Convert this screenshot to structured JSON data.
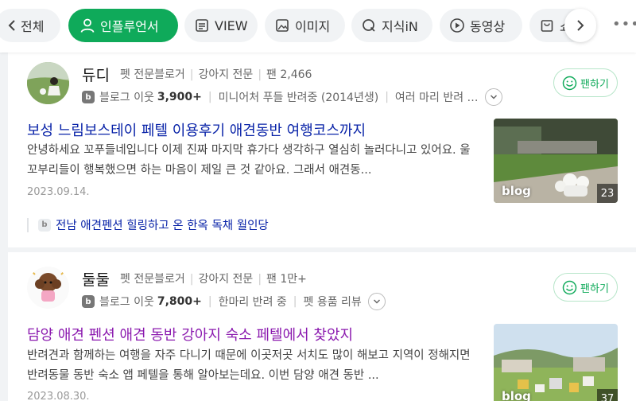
{
  "tabs": {
    "back_label": "전체",
    "influencer_label": "인플루언서",
    "view_label": "VIEW",
    "image_label": "이미지",
    "kin_label": "지식iN",
    "video_label": "동영상",
    "shop_label": "쇼"
  },
  "colors": {
    "accent": "#0faa5a",
    "link": "#0923a8",
    "visited": "#8b1aaf"
  },
  "results": [
    {
      "name": "듀디",
      "role": "펫 전문블로거",
      "specialty": "강아지 전문",
      "fans": "팬 2,466",
      "neighbors_label": "블로그 이웃",
      "neighbors_count": "3,900+",
      "tag1": "미니어처 푸들 반려중 (2014년생)",
      "tag2": "여러 마리 반려 …",
      "fan_button": "팬하기",
      "title": "보성 느림보스테이 페텔 이용후기 애견동반 여행코스까지",
      "desc": "안녕하세요 꼬푸들네입니다 이제 진짜 마지막 휴가다 생각하구 열심히 놀러다니고 있어요. 울 꼬부리들이 행복했으면 하는 마음이 제일 큰 것 같아요. 그래서 애견동...",
      "date": "2023.09.14.",
      "thumb_label": "blog",
      "thumb_count": "23",
      "related": "전남 애견펜션 힐링하고 온 한옥 독채 월인당"
    },
    {
      "name": "둘둘",
      "role": "펫 전문블로거",
      "specialty": "강아지 전문",
      "fans": "팬 1만+",
      "neighbors_label": "블로그 이웃",
      "neighbors_count": "7,800+",
      "tag1": "한마리 반려 중",
      "tag2": "펫 용품 리뷰",
      "fan_button": "팬하기",
      "title": "담양 애견 펜션 애견 동반 강아지 숙소 페텔에서 찾았지",
      "desc": "반려견과 함께하는 여행을 자주 다니기 때문에 이곳저곳 서치도 많이 해보고 지역이 정해지면 반려동물 동반 숙소 앱 페텔을 통해 알아보는데요. 이번 담양 애견 동반 ...",
      "date": "2023.08.30.",
      "thumb_label": "blog",
      "thumb_count": "37"
    }
  ]
}
